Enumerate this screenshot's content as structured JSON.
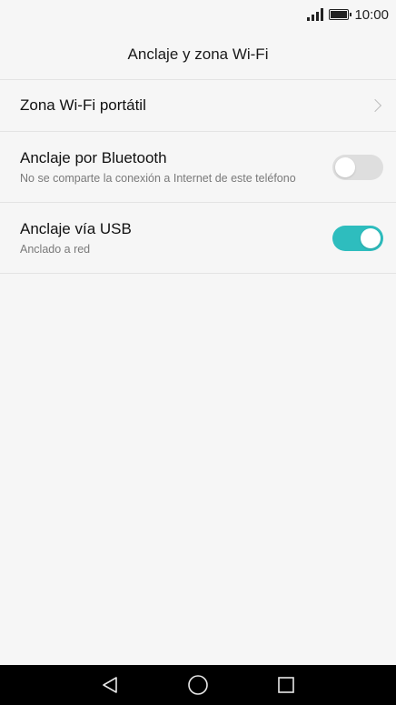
{
  "status_bar": {
    "time": "10:00",
    "icons": [
      "signal-icon",
      "battery-icon"
    ]
  },
  "header": {
    "title": "Anclaje y zona Wi-Fi"
  },
  "settings": [
    {
      "title": "Zona Wi-Fi portátil",
      "control": "chevron"
    },
    {
      "title": "Anclaje por Bluetooth",
      "subtitle": "No se comparte la conexión a Internet de este teléfono",
      "control": "toggle",
      "enabled": false
    },
    {
      "title": "Anclaje vía USB",
      "subtitle": "Anclado a red",
      "control": "toggle",
      "enabled": true
    }
  ],
  "nav_bar": {
    "icons": [
      "back-icon",
      "home-icon",
      "recents-icon"
    ]
  },
  "colors": {
    "accent": "#2ebdbe",
    "background": "#f6f6f6",
    "nav_bar": "#000000"
  }
}
